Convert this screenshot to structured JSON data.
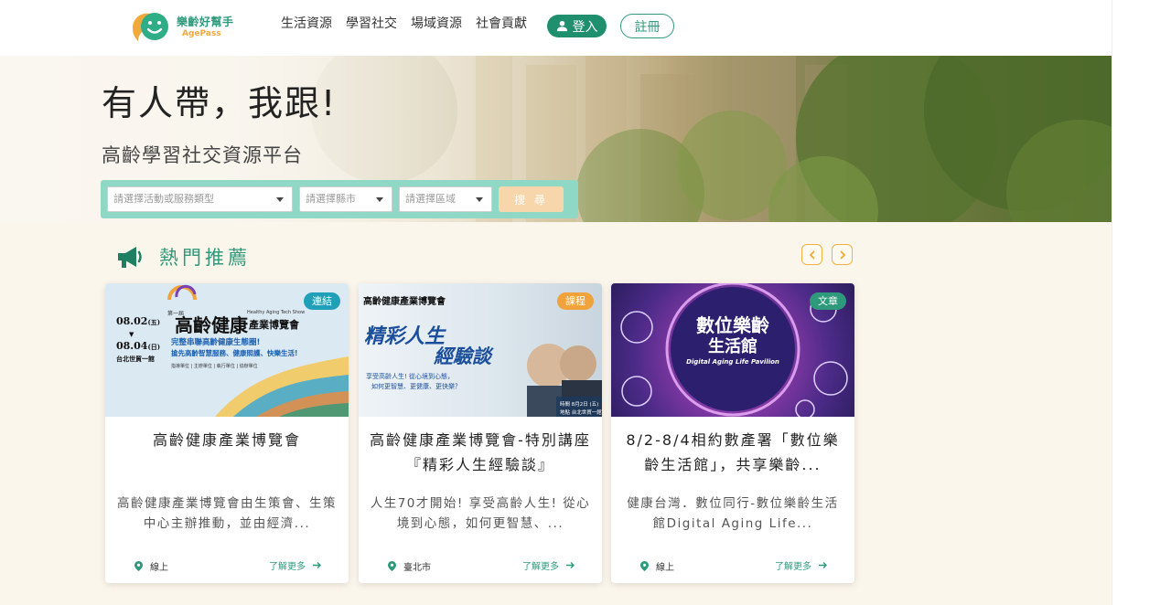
{
  "header": {
    "logo_cn": "樂齡好幫手",
    "logo_en": "AgePass",
    "nav": [
      "生活資源",
      "學習社交",
      "場域資源",
      "社會貢獻"
    ],
    "login_label": "登入",
    "register_label": "註冊"
  },
  "hero": {
    "title": "有人帶，我跟!",
    "subtitle": "高齡學習社交資源平台",
    "search": {
      "type_placeholder": "請選擇活動或服務類型",
      "city_placeholder": "請選擇縣市",
      "district_placeholder": "請選擇區域",
      "button_label": "搜 尋"
    }
  },
  "section": {
    "title": "熱門推薦",
    "icon": "megaphone-icon"
  },
  "cards": [
    {
      "badge": "連結",
      "badge_color": "#1f9fb8",
      "title": "高齡健康產業博覽會",
      "desc": "高齡健康產業博覽會由生策會、生策中心主辦推動，並由經濟...",
      "location": "線上",
      "more": "了解更多",
      "poster": {
        "dates": [
          "08.02",
          "08.04"
        ],
        "date_suffix": [
          "(五)",
          "(日)"
        ],
        "venue": "台北世貿一館",
        "edition": "第一屆",
        "heading": "高齡健康",
        "heading2": "產業博覽會",
        "en": "Healthy Aging Tech Show",
        "line1": "完整串聯高齡健康生態圈!",
        "line2": "搶先高齡智慧服務、健康照護、快樂生活!",
        "small": "指導單位 | 主辦單位 | 執行單位 | 協辦單位"
      }
    },
    {
      "badge": "課程",
      "badge_color": "#f0a23b",
      "title": "高齡健康產業博覽會-特別講座『精彩人生經驗談』",
      "desc": "人生70才開始! 享受高齡人生! 從心境到心態，如何更智慧、...",
      "location": "臺北市",
      "more": "了解更多",
      "poster": {
        "logo": "高齡健康產業博覽會",
        "heading1": "精彩人生",
        "heading2": "經驗談",
        "q1": "享受高齡人生! 從心境到心態，",
        "q2": "如何更智慧、更健康、更快樂？",
        "time": "時間 8月2日 (五)",
        "place": "地點 台北世貿一館"
      }
    },
    {
      "badge": "文章",
      "badge_color": "#2f9a7b",
      "title": "8/2-8/4相約數產署「數位樂齡生活館」，共享樂齡...",
      "desc": "健康台灣．數位同行-數位樂齡生活館Digital Aging Life...",
      "location": "線上",
      "more": "了解更多",
      "poster": {
        "heading1": "數位樂齡",
        "heading2": "生活館",
        "en": "Digital Aging Life Pavilion"
      }
    }
  ]
}
